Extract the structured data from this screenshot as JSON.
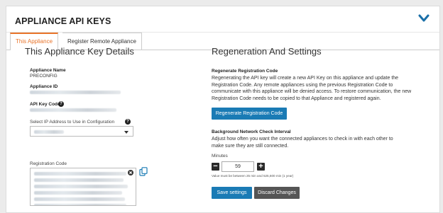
{
  "panel": {
    "title": "APPLIANCE API KEYS"
  },
  "tabs": [
    {
      "label": "This Appliance",
      "active": true
    },
    {
      "label": "Register Remote Appliance",
      "active": false
    }
  ],
  "details": {
    "heading": "This Appliance Key Details",
    "appliance_name_label": "Appliance Name",
    "appliance_name_value": "PRECONFIG",
    "appliance_id_label": "Appliance ID",
    "api_key_code_label": "API Key Code",
    "ip_label": "Select IP Address to Use in Configuration",
    "registration_code_label": "Registration Code"
  },
  "regeneration": {
    "heading": "Regeneration And Settings",
    "regen_label": "Regenerate Registration Code",
    "regen_text": "Regenerating the API key will create a new API Key on this appliance and update the Registration Code. Any remote appliances using the previous Registration Code to communicate with this appliance will be denied access. To restore communication, the new Registration Code needs to be copied to that Appliance and registered again.",
    "regen_button": "Regenerate Registration Code",
    "check_label": "Background Network Check Interval",
    "check_text": "Adjust how often you want the connected appliances to check in with each other to make sure they are still connected.",
    "minutes_label": "Minutes",
    "minutes_value": "59",
    "minutes_note": "Value must be between 25 min and 525,600 min (1 year)",
    "save_button": "Save settings",
    "discard_button": "Discard Changes"
  },
  "icons": {
    "chevron": "chevron-down-icon",
    "help": "help-icon",
    "clear": "clear-icon",
    "copy": "copy-icon"
  },
  "colors": {
    "accent_orange": "#e8742a",
    "button_blue": "#1a7bb5",
    "button_gray": "#555555",
    "chevron_blue": "#1a6fa8"
  }
}
